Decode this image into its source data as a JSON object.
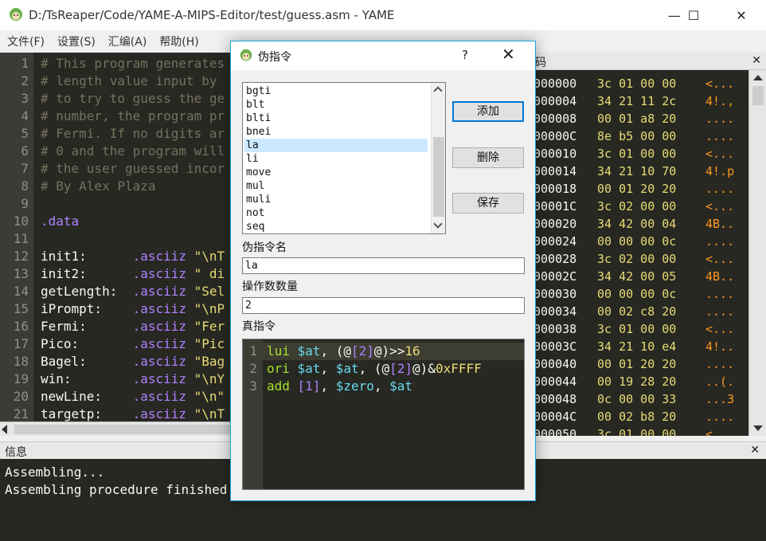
{
  "window": {
    "title": "D:/TsReaper/Code/YAME-A-MIPS-Editor/test/guess.asm - YAME",
    "minimize": "—",
    "maximize": "☐",
    "close": "✕"
  },
  "menu": [
    "文件(F)",
    "设置(S)",
    "汇编(A)",
    "帮助(H)"
  ],
  "editor": {
    "lines": [
      {
        "n": "1",
        "segs": [
          [
            "c-comment",
            "# This program generates"
          ]
        ]
      },
      {
        "n": "2",
        "segs": [
          [
            "c-comment",
            "# length value input by"
          ]
        ]
      },
      {
        "n": "3",
        "segs": [
          [
            "c-comment",
            "# to try to guess the ge"
          ]
        ]
      },
      {
        "n": "4",
        "segs": [
          [
            "c-comment",
            "# number, the program pr"
          ]
        ]
      },
      {
        "n": "5",
        "segs": [
          [
            "c-comment",
            "# Fermi. If no digits ar"
          ]
        ]
      },
      {
        "n": "6",
        "segs": [
          [
            "c-comment",
            "# 0 and the program will"
          ]
        ]
      },
      {
        "n": "7",
        "segs": [
          [
            "c-comment",
            "# the user guessed incor"
          ]
        ]
      },
      {
        "n": "8",
        "segs": [
          [
            "c-comment",
            "# By Alex Plaza"
          ]
        ]
      },
      {
        "n": "9",
        "segs": []
      },
      {
        "n": "10",
        "segs": [
          [
            "c-kw",
            ".data"
          ]
        ]
      },
      {
        "n": "11",
        "segs": []
      },
      {
        "n": "12",
        "segs": [
          [
            "c-label",
            "init1:      "
          ],
          [
            "c-kw",
            ".asciiz "
          ],
          [
            "c-str",
            "\"\\nT"
          ]
        ]
      },
      {
        "n": "13",
        "segs": [
          [
            "c-label",
            "init2:      "
          ],
          [
            "c-kw",
            ".asciiz "
          ],
          [
            "c-str",
            "\" di"
          ]
        ]
      },
      {
        "n": "14",
        "segs": [
          [
            "c-label",
            "getLength:  "
          ],
          [
            "c-kw",
            ".asciiz "
          ],
          [
            "c-str",
            "\"Sel"
          ]
        ]
      },
      {
        "n": "15",
        "segs": [
          [
            "c-label",
            "iPrompt:    "
          ],
          [
            "c-kw",
            ".asciiz "
          ],
          [
            "c-str",
            "\"\\nP"
          ]
        ]
      },
      {
        "n": "16",
        "segs": [
          [
            "c-label",
            "Fermi:      "
          ],
          [
            "c-kw",
            ".asciiz "
          ],
          [
            "c-str",
            "\"Fer"
          ]
        ]
      },
      {
        "n": "17",
        "segs": [
          [
            "c-label",
            "Pico:       "
          ],
          [
            "c-kw",
            ".asciiz "
          ],
          [
            "c-str",
            "\"Pic"
          ]
        ]
      },
      {
        "n": "18",
        "segs": [
          [
            "c-label",
            "Bagel:      "
          ],
          [
            "c-kw",
            ".asciiz "
          ],
          [
            "c-str",
            "\"Bag"
          ]
        ]
      },
      {
        "n": "19",
        "segs": [
          [
            "c-label",
            "win:        "
          ],
          [
            "c-kw",
            ".asciiz "
          ],
          [
            "c-str",
            "\"\\nY"
          ]
        ]
      },
      {
        "n": "20",
        "segs": [
          [
            "c-label",
            "newLine:    "
          ],
          [
            "c-kw",
            ".asciiz "
          ],
          [
            "c-str",
            "\"\\n\""
          ]
        ]
      },
      {
        "n": "21",
        "segs": [
          [
            "c-label",
            "targetp:    "
          ],
          [
            "c-kw",
            ".asciiz "
          ],
          [
            "c-str",
            "\"\\nT"
          ]
        ]
      }
    ]
  },
  "hex": {
    "title": "码",
    "rows": [
      {
        "addr": "000000",
        "bytes": "3c 01 00 00",
        "ascii": "<..."
      },
      {
        "addr": "000004",
        "bytes": "34 21 11 2c",
        "ascii": "4!.,"
      },
      {
        "addr": "000008",
        "bytes": "00 01 a8 20",
        "ascii": "...."
      },
      {
        "addr": "00000C",
        "bytes": "8e b5 00 00",
        "ascii": "...."
      },
      {
        "addr": "000010",
        "bytes": "3c 01 00 00",
        "ascii": "<..."
      },
      {
        "addr": "000014",
        "bytes": "34 21 10 70",
        "ascii": "4!.p"
      },
      {
        "addr": "000018",
        "bytes": "00 01 20 20",
        "ascii": "...."
      },
      {
        "addr": "00001C",
        "bytes": "3c 02 00 00",
        "ascii": "<..."
      },
      {
        "addr": "000020",
        "bytes": "34 42 00 04",
        "ascii": "4B.."
      },
      {
        "addr": "000024",
        "bytes": "00 00 00 0c",
        "ascii": "...."
      },
      {
        "addr": "000028",
        "bytes": "3c 02 00 00",
        "ascii": "<..."
      },
      {
        "addr": "00002C",
        "bytes": "34 42 00 05",
        "ascii": "4B.."
      },
      {
        "addr": "000030",
        "bytes": "00 00 00 0c",
        "ascii": "...."
      },
      {
        "addr": "000034",
        "bytes": "00 02 c8 20",
        "ascii": "...."
      },
      {
        "addr": "000038",
        "bytes": "3c 01 00 00",
        "ascii": "<..."
      },
      {
        "addr": "00003C",
        "bytes": "34 21 10 e4",
        "ascii": "4!.."
      },
      {
        "addr": "000040",
        "bytes": "00 01 20 20",
        "ascii": "...."
      },
      {
        "addr": "000044",
        "bytes": "00 19 28 20",
        "ascii": "..(."
      },
      {
        "addr": "000048",
        "bytes": "0c 00 00 33",
        "ascii": "...3"
      },
      {
        "addr": "00004C",
        "bytes": "00 02 b8 20",
        "ascii": "...."
      },
      {
        "addr": "000050",
        "bytes": "3c 01 00 00",
        "ascii": "<..."
      }
    ]
  },
  "info": {
    "title": "信息",
    "lines": [
      "Assembling...",
      "Assembling procedure finished"
    ]
  },
  "dialog": {
    "title": "伪指令",
    "help": "?",
    "close": "✕",
    "list": [
      "bgti",
      "blt",
      "blti",
      "bnei",
      "la",
      "li",
      "move",
      "mul",
      "muli",
      "not",
      "seq"
    ],
    "selected": "la",
    "buttons": {
      "add": "添加",
      "delete": "删除",
      "save": "保存"
    },
    "name_label": "伪指令名",
    "name_value": "la",
    "count_label": "操作数数量",
    "count_value": "2",
    "real_label": "真指令",
    "real_lines": [
      {
        "n": "1",
        "segs": [
          [
            "t-op",
            "lui "
          ],
          [
            "t-reg",
            "$at"
          ],
          [
            "t-punc",
            ", (@"
          ],
          [
            "t-ph",
            "[2]"
          ],
          [
            "t-punc",
            "@)>>"
          ],
          [
            "t-num",
            "16"
          ]
        ]
      },
      {
        "n": "2",
        "segs": [
          [
            "t-op",
            "ori "
          ],
          [
            "t-reg",
            "$at"
          ],
          [
            "t-punc",
            ", "
          ],
          [
            "t-reg",
            "$at"
          ],
          [
            "t-punc",
            ", (@"
          ],
          [
            "t-ph",
            "[2]"
          ],
          [
            "t-punc",
            "@)&"
          ],
          [
            "t-num",
            "0xFFFF"
          ]
        ]
      },
      {
        "n": "3",
        "segs": [
          [
            "t-op",
            "add "
          ],
          [
            "t-ph",
            "[1]"
          ],
          [
            "t-punc",
            ", "
          ],
          [
            "t-reg",
            "$zero"
          ],
          [
            "t-punc",
            ", "
          ],
          [
            "t-reg",
            "$at"
          ]
        ]
      }
    ]
  }
}
